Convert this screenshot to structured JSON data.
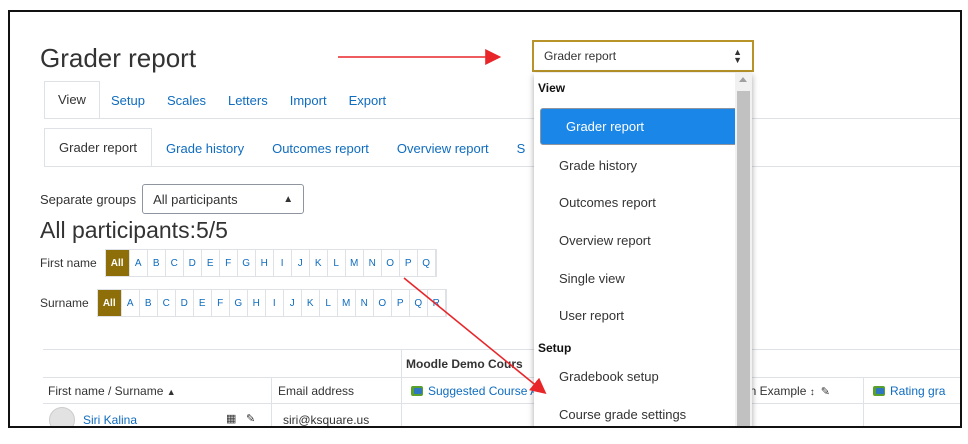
{
  "page": {
    "title": "Grader report"
  },
  "tabs_primary": [
    "View",
    "Setup",
    "Scales",
    "Letters",
    "Import",
    "Export"
  ],
  "tabs_secondary": [
    "Grader report",
    "Grade history",
    "Outcomes report",
    "Overview report",
    "S"
  ],
  "groups": {
    "label": "Separate groups",
    "value": "All participants"
  },
  "participants_heading": "All participants:5/5",
  "initials_first": {
    "label": "First name",
    "all": "All",
    "letters": [
      "A",
      "B",
      "C",
      "D",
      "E",
      "F",
      "G",
      "H",
      "I",
      "J",
      "K",
      "L",
      "M",
      "N",
      "O",
      "P",
      "Q"
    ]
  },
  "initials_surname": {
    "label": "Surname",
    "all": "All",
    "letters": [
      "A",
      "B",
      "C",
      "D",
      "E",
      "F",
      "G",
      "H",
      "I",
      "J",
      "K",
      "L",
      "M",
      "N",
      "O",
      "P",
      "Q",
      "R"
    ]
  },
  "table": {
    "course_header": "Moodle Demo Cours",
    "col_name": "First name / Surname",
    "col_email": "Email address",
    "col_suggested": "Suggested Course A",
    "col_example": "on Example",
    "col_rating": "Rating gra",
    "row1_name": "Siri Kalina",
    "row1_email": "siri@ksquare.us"
  },
  "dropdown": {
    "selected": "Grader report",
    "group_view": "View",
    "view_options": [
      "Grader report",
      "Grade history",
      "Outcomes report",
      "Overview report",
      "Single view",
      "User report"
    ],
    "group_setup": "Setup",
    "setup_options": [
      "Gradebook setup",
      "Course grade settings"
    ]
  },
  "colors": {
    "accent_all": "#8d6e09",
    "link": "#0f6cbf",
    "selected_option": "#1a86e8",
    "annotation_arrow": "#e8262a",
    "dropdown_border": "#b8932a"
  }
}
